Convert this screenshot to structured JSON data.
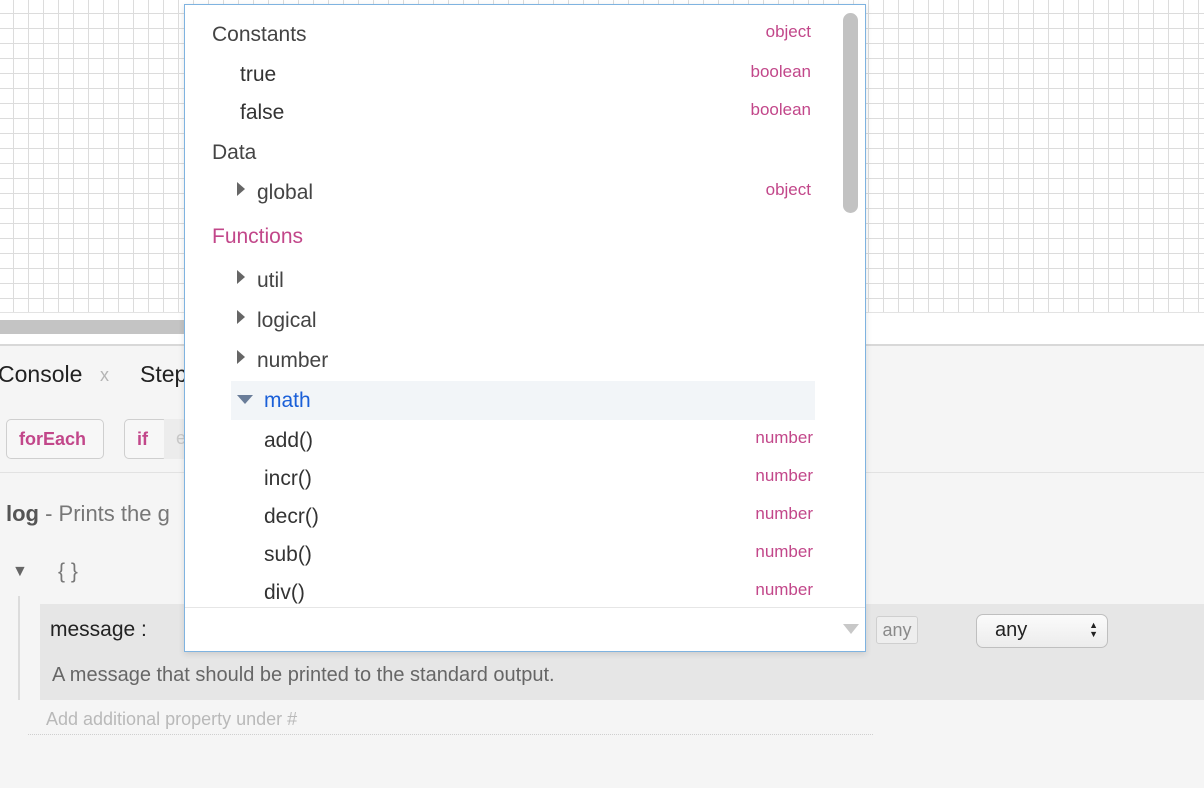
{
  "tabs": [
    {
      "label": "Console",
      "close": "x"
    },
    {
      "label": "Step"
    }
  ],
  "toolbar": {
    "foreach_label": "forEach",
    "if_label": "if",
    "partial_label": "e"
  },
  "step": {
    "name": "log",
    "description": " - Prints the g"
  },
  "schema": {
    "toggle": "▼",
    "braces": "{ }",
    "property": {
      "name": "message :",
      "type_chip": "any",
      "type_select": "any",
      "description": "A message that should be printed to the standard output."
    },
    "add_property": "Add additional property under #"
  },
  "dropdown": {
    "input_value": "",
    "items": [
      {
        "label": "Constants",
        "type": "object"
      },
      {
        "label": "true",
        "type": "boolean"
      },
      {
        "label": "false",
        "type": "boolean"
      },
      {
        "label": "Data",
        "type": ""
      },
      {
        "label": "global",
        "type": "object"
      },
      {
        "label": "Functions",
        "type": ""
      },
      {
        "label": "util",
        "type": ""
      },
      {
        "label": "logical",
        "type": ""
      },
      {
        "label": "number",
        "type": ""
      },
      {
        "label": "math",
        "type": ""
      },
      {
        "label": "add()",
        "type": "number"
      },
      {
        "label": "incr()",
        "type": "number"
      },
      {
        "label": "decr()",
        "type": "number"
      },
      {
        "label": "sub()",
        "type": "number"
      },
      {
        "label": "div()",
        "type": "number"
      }
    ]
  },
  "colors": {
    "accent": "#c2478a",
    "selected": "#1a5fd8",
    "border_focus": "#7fb3e0"
  }
}
